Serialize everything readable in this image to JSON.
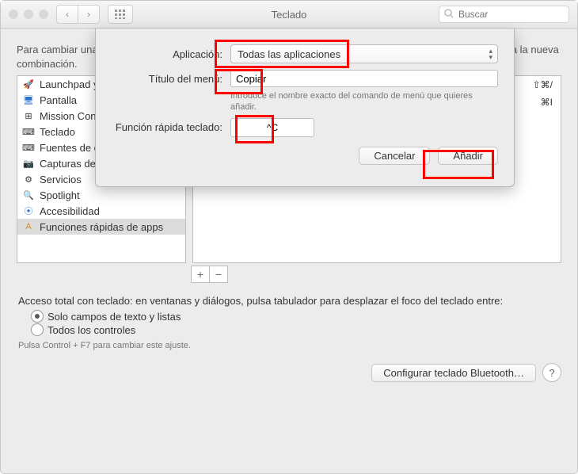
{
  "window": {
    "title": "Teclado",
    "search_placeholder": "Buscar"
  },
  "main": {
    "desc": "Para cambiar una función rápida, selecciona su casilla, haz clic en la combinación de teclas y, después, pulsa la nueva combinación.",
    "sidebar_items": [
      {
        "label": "Launchpad y Dock"
      },
      {
        "label": "Pantalla"
      },
      {
        "label": "Mission Control"
      },
      {
        "label": "Teclado"
      },
      {
        "label": "Fuentes de entrada"
      },
      {
        "label": "Capturas de pantalla"
      },
      {
        "label": "Servicios"
      },
      {
        "label": "Spotlight"
      },
      {
        "label": "Accesibilidad"
      },
      {
        "label": "Funciones rápidas de apps"
      }
    ],
    "shortcut_rows": [
      {
        "label": "",
        "keys": "⇧⌘/"
      },
      {
        "label": "",
        "keys": "⌘I"
      }
    ],
    "plus": "+",
    "minus": "−",
    "fulltext": "Acceso total con teclado: en ventanas y diálogos, pulsa tabulador para desplazar el foco del teclado entre:",
    "radio1": "Solo campos de texto y listas",
    "radio2": "Todos los controles",
    "hint": "Pulsa Control + F7 para cambiar este ajuste.",
    "bluetooth_btn": "Configurar teclado Bluetooth…"
  },
  "sheet": {
    "app_label": "Aplicación:",
    "app_value": "Todas las aplicaciones",
    "title_label": "Título del menú:",
    "title_value": "Copiar",
    "title_hint": "Introduce el nombre exacto del comando de menú que quieres añadir.",
    "shortcut_label": "Función rápida teclado:",
    "shortcut_value": "^C",
    "cancel": "Cancelar",
    "add": "Añadir"
  }
}
